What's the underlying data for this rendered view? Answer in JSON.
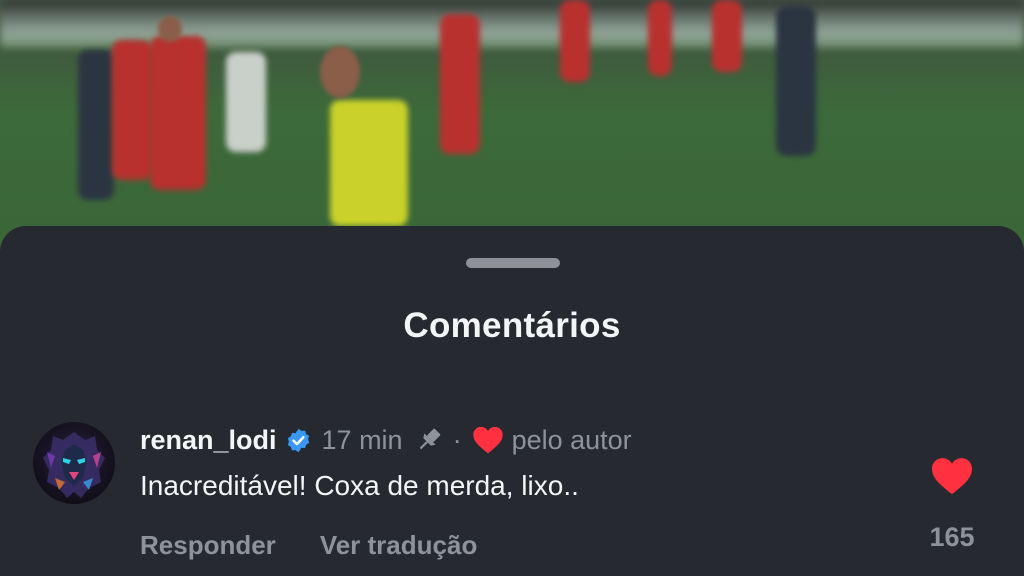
{
  "sheet": {
    "title": "Comentários"
  },
  "comment": {
    "username": "renan_lodi",
    "verified": true,
    "time": "17 min",
    "separator": "·",
    "liked_by_author_label": "pelo autor",
    "text": "Inacreditável! Coxa de merda, lixo..",
    "reply_label": "Responder",
    "translate_label": "Ver tradução",
    "like_count": "165",
    "liked": true
  },
  "colors": {
    "sheet_background": "#262a30",
    "like_red": "#ff3040",
    "verified_blue": "#3897f0",
    "secondary_text": "#8e939a"
  },
  "icons": {
    "verified": "verified-badge-icon",
    "pinned": "pin-icon",
    "author_like": "heart-icon",
    "like": "heart-icon"
  }
}
